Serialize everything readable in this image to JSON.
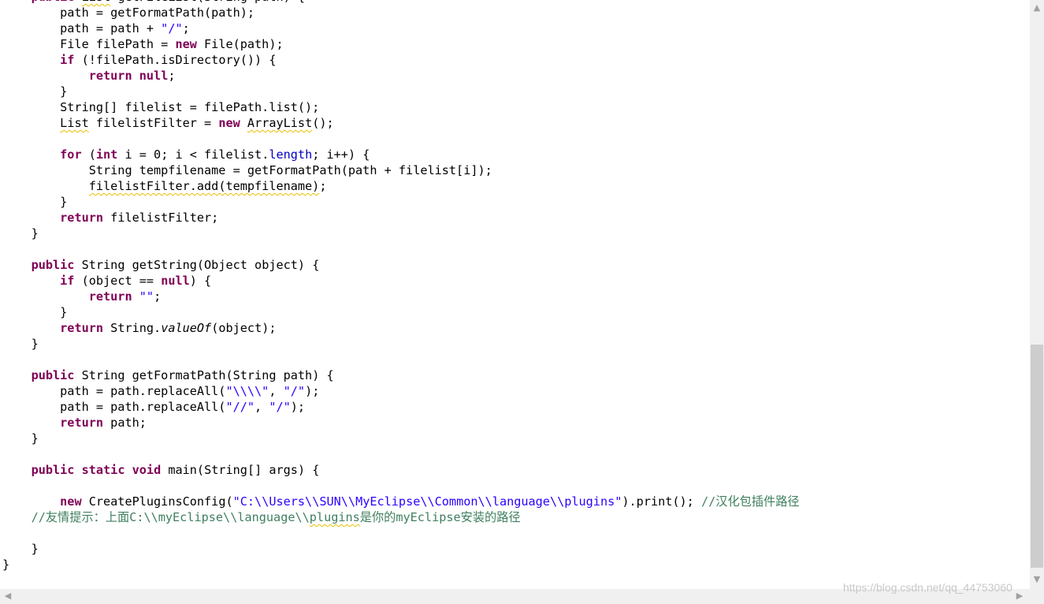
{
  "editor": {
    "colors": {
      "keyword": "#7f0055",
      "string": "#2a00ff",
      "field": "#0000c0",
      "comment": "#3f7f5f",
      "warning_underline": "#e8c000"
    },
    "lines": [
      [
        {
          "t": "    "
        },
        {
          "t": "public",
          "c": "kw"
        },
        {
          "t": " "
        },
        {
          "t": "List",
          "w": 1
        },
        {
          "t": " getFileList(String path) {"
        }
      ],
      [
        {
          "t": "        path = getFormatPath(path);"
        }
      ],
      [
        {
          "t": "        path = path + "
        },
        {
          "t": "\"/\"",
          "c": "str"
        },
        {
          "t": ";"
        }
      ],
      [
        {
          "t": "        File filePath = "
        },
        {
          "t": "new",
          "c": "kw"
        },
        {
          "t": " File(path);"
        }
      ],
      [
        {
          "t": "        "
        },
        {
          "t": "if",
          "c": "kw"
        },
        {
          "t": " (!filePath.isDirectory()) {"
        }
      ],
      [
        {
          "t": "            "
        },
        {
          "t": "return",
          "c": "kw"
        },
        {
          "t": " "
        },
        {
          "t": "null",
          "c": "kw"
        },
        {
          "t": ";"
        }
      ],
      [
        {
          "t": "        }"
        }
      ],
      [
        {
          "t": "        String[] filelist = filePath.list();"
        }
      ],
      [
        {
          "t": "        "
        },
        {
          "t": "List",
          "w": 1
        },
        {
          "t": " filelistFilter = "
        },
        {
          "t": "new",
          "c": "kw"
        },
        {
          "t": " "
        },
        {
          "t": "ArrayList",
          "w": 1
        },
        {
          "t": "();"
        }
      ],
      [
        {
          "t": ""
        }
      ],
      [
        {
          "t": "        "
        },
        {
          "t": "for",
          "c": "kw"
        },
        {
          "t": " ("
        },
        {
          "t": "int",
          "c": "kw"
        },
        {
          "t": " i = 0; i < filelist."
        },
        {
          "t": "length",
          "c": "fld"
        },
        {
          "t": "; i++) {"
        }
      ],
      [
        {
          "t": "            String tempfilename = getFormatPath(path + filelist[i]);"
        }
      ],
      [
        {
          "t": "            "
        },
        {
          "t": "filelistFilter.add(tempfilename)",
          "w": 1
        },
        {
          "t": ";"
        }
      ],
      [
        {
          "t": "        }"
        }
      ],
      [
        {
          "t": "        "
        },
        {
          "t": "return",
          "c": "kw"
        },
        {
          "t": " filelistFilter;"
        }
      ],
      [
        {
          "t": "    }"
        }
      ],
      [
        {
          "t": ""
        }
      ],
      [
        {
          "t": "    "
        },
        {
          "t": "public",
          "c": "kw"
        },
        {
          "t": " String getString(Object object) {"
        }
      ],
      [
        {
          "t": "        "
        },
        {
          "t": "if",
          "c": "kw"
        },
        {
          "t": " (object == "
        },
        {
          "t": "null",
          "c": "kw"
        },
        {
          "t": ") {"
        }
      ],
      [
        {
          "t": "            "
        },
        {
          "t": "return",
          "c": "kw"
        },
        {
          "t": " "
        },
        {
          "t": "\"\"",
          "c": "str"
        },
        {
          "t": ";"
        }
      ],
      [
        {
          "t": "        }"
        }
      ],
      [
        {
          "t": "        "
        },
        {
          "t": "return",
          "c": "kw"
        },
        {
          "t": " String."
        },
        {
          "t": "valueOf",
          "c": "it"
        },
        {
          "t": "(object);"
        }
      ],
      [
        {
          "t": "    }"
        }
      ],
      [
        {
          "t": ""
        }
      ],
      [
        {
          "t": "    "
        },
        {
          "t": "public",
          "c": "kw"
        },
        {
          "t": " String getFormatPath(String path) {"
        }
      ],
      [
        {
          "t": "        path = path.replaceAll("
        },
        {
          "t": "\"\\\\\\\\\"",
          "c": "str"
        },
        {
          "t": ", "
        },
        {
          "t": "\"/\"",
          "c": "str"
        },
        {
          "t": ");"
        }
      ],
      [
        {
          "t": "        path = path.replaceAll("
        },
        {
          "t": "\"//\"",
          "c": "str"
        },
        {
          "t": ", "
        },
        {
          "t": "\"/\"",
          "c": "str"
        },
        {
          "t": ");"
        }
      ],
      [
        {
          "t": "        "
        },
        {
          "t": "return",
          "c": "kw"
        },
        {
          "t": " path;"
        }
      ],
      [
        {
          "t": "    }"
        }
      ],
      [
        {
          "t": ""
        }
      ],
      [
        {
          "t": "    "
        },
        {
          "t": "public",
          "c": "kw"
        },
        {
          "t": " "
        },
        {
          "t": "static",
          "c": "kw"
        },
        {
          "t": " "
        },
        {
          "t": "void",
          "c": "kw"
        },
        {
          "t": " main(String[] args) {"
        }
      ],
      [
        {
          "t": ""
        }
      ],
      [
        {
          "t": "        "
        },
        {
          "t": "new",
          "c": "kw"
        },
        {
          "t": " CreatePluginsConfig("
        },
        {
          "t": "\"C:\\\\Users\\\\SUN\\\\MyEclipse\\\\Common\\\\language\\\\plugins\"",
          "c": "str"
        },
        {
          "t": ").print(); "
        },
        {
          "t": "//汉化包插件路径",
          "c": "cm"
        }
      ],
      [
        {
          "t": "    "
        },
        {
          "t": "//友情提示：上面C:\\\\myEclipse\\\\language\\\\",
          "c": "cm"
        },
        {
          "t": "plugins",
          "c": "cm",
          "w": 1
        },
        {
          "t": "是你的myEclipse安装的路径",
          "c": "cm"
        }
      ],
      [
        {
          "t": ""
        }
      ],
      [
        {
          "t": "    }"
        }
      ],
      [
        {
          "t": "}"
        }
      ]
    ]
  },
  "scrollbar": {
    "up_arrow": "▲",
    "down_arrow": "▼",
    "left_arrow": "◀",
    "right_arrow": "▶"
  },
  "watermark": {
    "text": "https://blog.csdn.net/qq_44753060"
  }
}
